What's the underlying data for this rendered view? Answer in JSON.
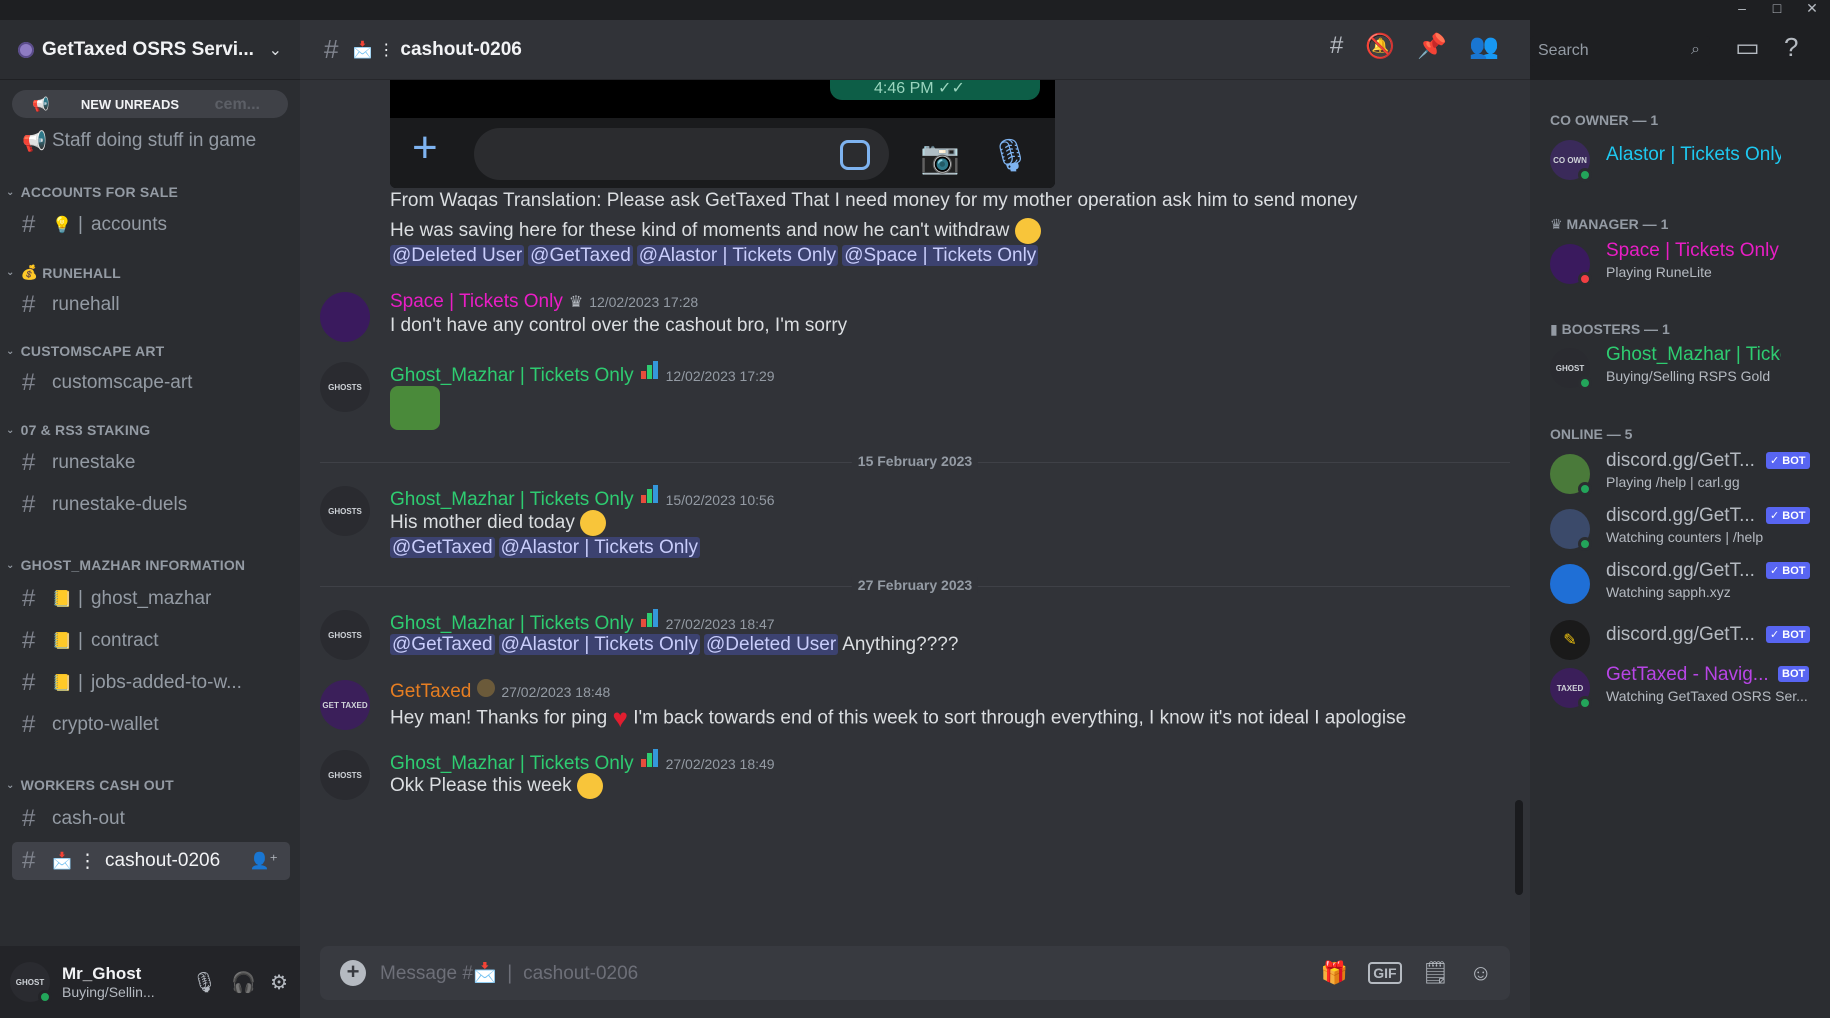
{
  "window": {
    "minimize": "–",
    "maximize": "□",
    "close": "✕"
  },
  "server": {
    "name": "GetTaxed OSRS Servi..."
  },
  "sidebar": {
    "new_unreads": "NEW UNREADS",
    "peek_left": "📢",
    "peek_right": "cem...",
    "staff_channel": "Staff doing stuff in game",
    "categories": [
      {
        "label": "ACCOUNTS FOR SALE"
      },
      {
        "label": "RUNEHALL",
        "emoji": "💰"
      },
      {
        "label": "CUSTOMSCAPE ART"
      },
      {
        "label": "07 & RS3 STAKING"
      },
      {
        "label": "GHOST_MAZHAR INFORMATION"
      },
      {
        "label": "WORKERS CASH OUT"
      }
    ],
    "channels": {
      "accounts": "accounts",
      "runehall": "runehall",
      "customscape_art": "customscape-art",
      "runestake": "runestake",
      "runestake_duels": "runestake-duels",
      "ghost_mazhar": "ghost_mazhar",
      "contract": "contract",
      "jobs_added": "jobs-added-to-w...",
      "crypto_wallet": "crypto-wallet",
      "cash_out": "cash-out",
      "cashout_0206": "cashout-0206"
    }
  },
  "user": {
    "name": "Mr_Ghost",
    "status": "Buying/Sellin...",
    "avatar_text": "GHOST"
  },
  "header": {
    "channel": "cashout-0206",
    "search_placeholder": "Search"
  },
  "messages": {
    "translation": "From Waqas Translation: Please ask GetTaxed That I need money for my mother operation ask him to send money",
    "saving": "He was saving here for these kind of moments and now he can't withdraw",
    "mentions1": [
      "@Deleted User",
      "@GetTaxed",
      "@Alastor | Tickets Only",
      "@Space | Tickets Only"
    ],
    "embed_time": "4:46 PM ✓✓",
    "m1": {
      "author": "Space | Tickets Only",
      "time": "12/02/2023 17:28",
      "text": "I don't have any control over the cashout bro, I'm sorry",
      "color": "#e91ec5"
    },
    "m2": {
      "author": "Ghost_Mazhar | Tickets Only",
      "time": "12/02/2023 17:29",
      "color": "#2ecc71",
      "avatar_text": "GHOSTS"
    },
    "divider1": "15 February 2023",
    "m3": {
      "author": "Ghost_Mazhar | Tickets Only",
      "time": "15/02/2023 10:56",
      "text": "His mother died today",
      "mentions": [
        "@GetTaxed",
        "@Alastor | Tickets Only"
      ]
    },
    "divider2": "27 February 2023",
    "m4": {
      "author": "Ghost_Mazhar | Tickets Only",
      "time": "27/02/2023 18:47",
      "mentions": [
        "@GetTaxed",
        "@Alastor | Tickets Only",
        "@Deleted User"
      ],
      "text": "Anything????"
    },
    "m5": {
      "author": "GetTaxed",
      "time": "27/02/2023 18:48",
      "text_a": "Hey man! Thanks for ping",
      "text_b": "I'm back towards end of this week to sort through everything, I know it's not ideal I apologise",
      "color": "#e67e22",
      "avatar_text": "GET TAXED"
    },
    "m6": {
      "author": "Ghost_Mazhar | Tickets Only",
      "time": "27/02/2023 18:49",
      "text": "Okk Please this week"
    }
  },
  "composer": {
    "placeholder": "Message #📩 ❘ cashout-0206",
    "gif": "GIF"
  },
  "members": {
    "cat_owner": "CO OWNER — 1",
    "cat_manager": "MANAGER — 1",
    "cat_boosters": "BOOSTERS — 1",
    "cat_online": "ONLINE — 5",
    "bot_label": "✓ BOT",
    "list": [
      {
        "name": "Alastor | Tickets Only",
        "status": "",
        "color": "#1ec8f0",
        "avatar_text": "CO OWN"
      },
      {
        "name": "Space | Tickets Only",
        "status": "Playing RuneLite",
        "color": "#e91ec5"
      },
      {
        "name": "Ghost_Mazhar | Ticke...",
        "status": "Buying/Selling RSPS Gold",
        "color": "#2ecc71",
        "avatar_text": "GHOST"
      },
      {
        "name": "discord.gg/GetT...",
        "status": "Playing /help | carl.gg",
        "color": "#b5bac1"
      },
      {
        "name": "discord.gg/GetT...",
        "status": "Watching counters | /help",
        "color": "#b5bac1"
      },
      {
        "name": "discord.gg/GetT...",
        "status": "Watching sapph.xyz",
        "color": "#b5bac1"
      },
      {
        "name": "discord.gg/GetT...",
        "status": "",
        "color": "#b5bac1"
      },
      {
        "name": "GetTaxed - Navig...",
        "status": "Watching GetTaxed OSRS Ser...",
        "color": "#b845e6",
        "avatar_text": "TAXED"
      }
    ]
  }
}
